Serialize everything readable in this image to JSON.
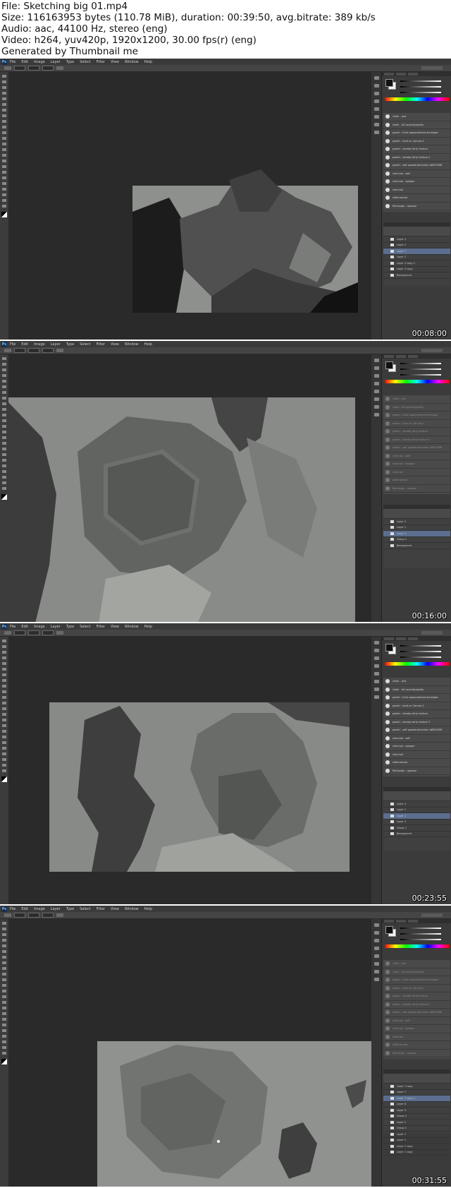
{
  "header": {
    "file": "File: Sketching big 01.mp4",
    "size": "Size: 116163953 bytes (110.78 MiB), duration: 00:39:50, avg.bitrate: 389 kb/s",
    "audio": "Audio: aac, 44100 Hz, stereo (eng)",
    "video": "Video: h264, yuv420p, 1920x1200, 30.00 fps(r) (eng)",
    "generated": "Generated by Thumbnail me"
  },
  "app": {
    "logo": "Ps",
    "menu": [
      "File",
      "Edit",
      "Image",
      "Layer",
      "Type",
      "Select",
      "Filter",
      "View",
      "Window",
      "Help"
    ]
  },
  "brushes": [
    "chalk - wet",
    "chalk - full opacity/spotty",
    "pastel - thick opaque/textured edges",
    "pastel - hard on Canvas 2",
    "pastel - streaky dirty texture",
    "pastel - streaky dirty texture 2",
    "pastel - soft powder/direction AWESOME",
    "charcoal - soft",
    "charcoal - opaque",
    "charcoal",
    "softcharcoal",
    "Rectangle - opaque"
  ],
  "frames": [
    {
      "timestamp": "00:08:00",
      "layers": [
        "Layer 4",
        "Layer 2",
        "Layer 1",
        "Layer 3",
        "Layer 3 copy 2",
        "Layer 3 copy",
        "Background"
      ]
    },
    {
      "timestamp": "00:16:00",
      "layers": [
        "Layer 4",
        "Layer 1",
        "Layer 2",
        "Group 1",
        "Background"
      ]
    },
    {
      "timestamp": "00:23:55",
      "layers": [
        "Layer 4",
        "Layer 1",
        "Layer 2",
        "Layer 3",
        "Group 1",
        "Background"
      ]
    },
    {
      "timestamp": "00:31:55",
      "layers": [
        "Layer 7 copy",
        "Layer 7",
        "Layer 7 copy 2",
        "Layer 6",
        "Layer 5",
        "Group 2",
        "Layer 1",
        "Group 1",
        "Layer 3",
        "Layer 2",
        "Layer 2 copy",
        "Layer 1 copy"
      ]
    }
  ]
}
